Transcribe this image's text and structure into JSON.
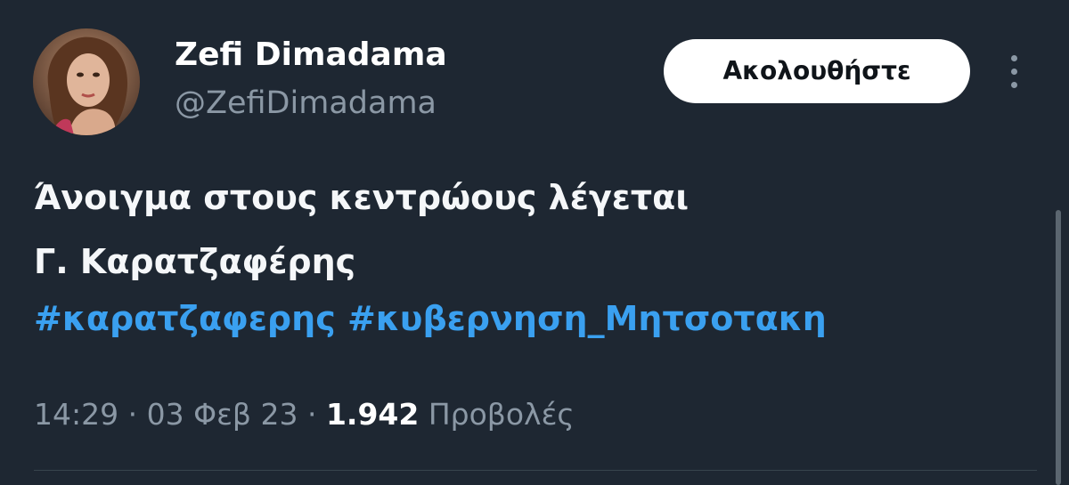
{
  "tweet": {
    "author": {
      "display_name": "Zefi Dimadama",
      "handle": "@ZefiDimadama"
    },
    "follow_label": "Ακολουθήστε",
    "more_icon": "more-vertical-icon",
    "text_lines": [
      "Άνοιγμα στους κεντρώους λέγεται",
      "Γ. Καρατζαφέρης"
    ],
    "hashtags": [
      "#καρατζαφερης",
      "#κυβερνηση_Μητσοτακη"
    ],
    "meta": {
      "time": "14:29",
      "separator": "·",
      "date": "03 Φεβ 23",
      "views_count": "1.942",
      "views_label": "Προβολές"
    }
  },
  "colors": {
    "background": "#1e2732",
    "text": "#f5f7f9",
    "secondary_text": "#8b98a5",
    "link": "#3aa0f0",
    "follow_button_bg": "#ffffff",
    "divider": "#38444d"
  }
}
